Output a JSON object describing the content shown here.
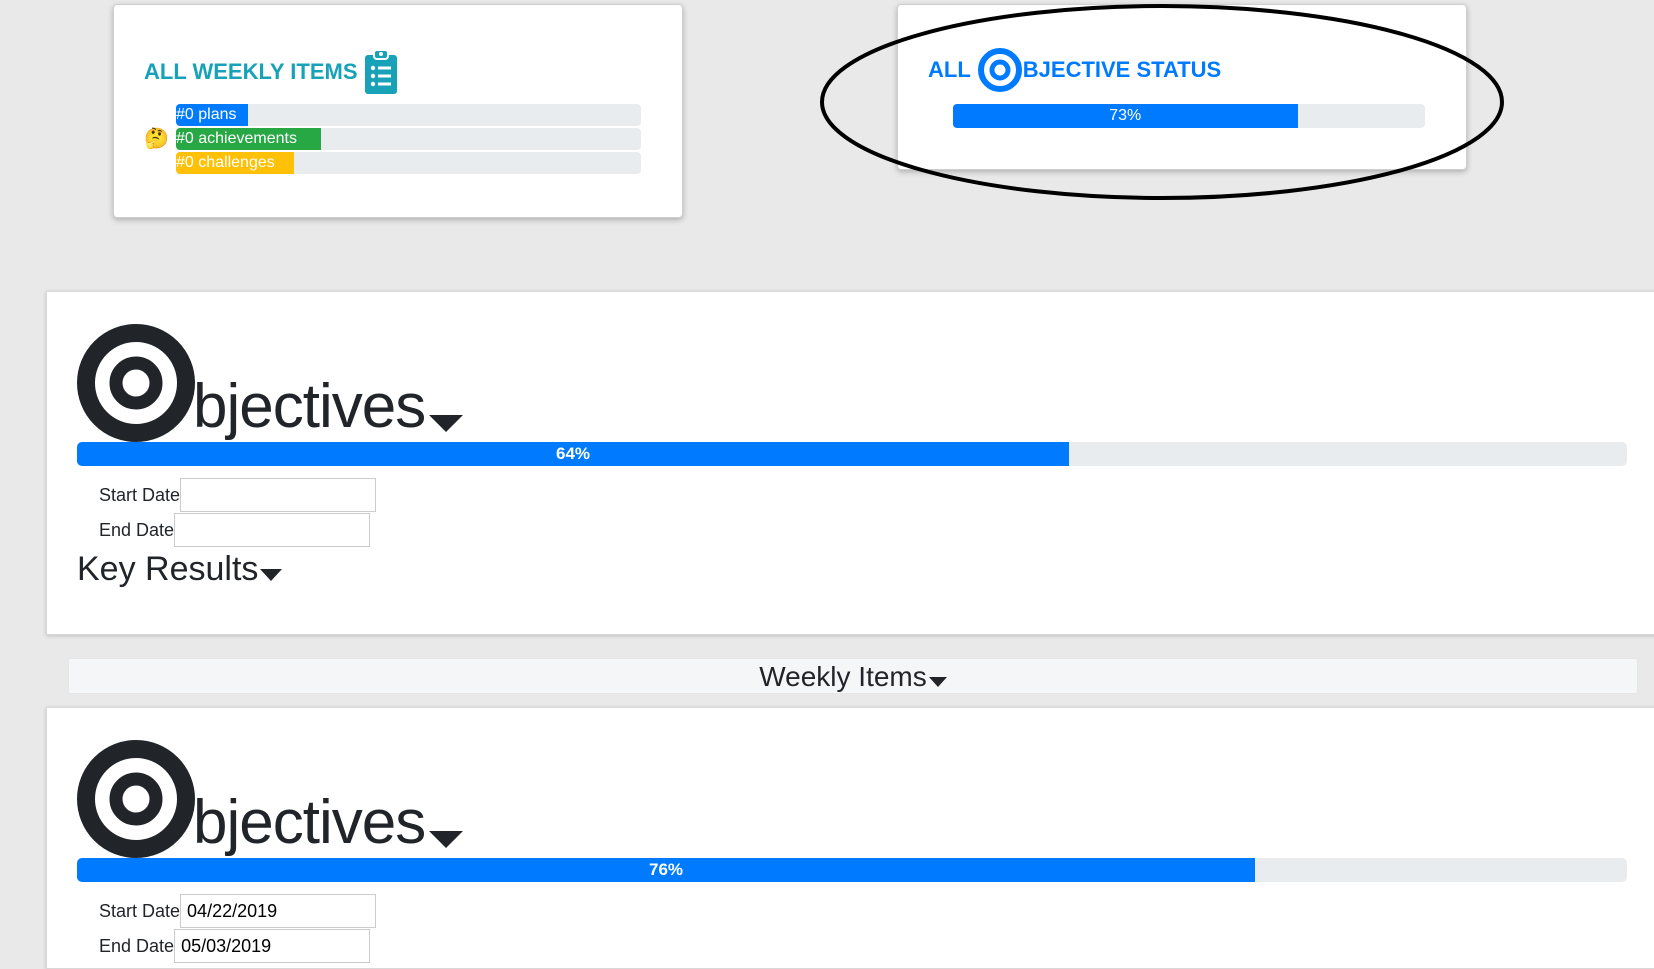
{
  "weekly_card": {
    "title": "ALL WEEKLY ITEMS",
    "icon": "clipboard-list-icon",
    "emoji": "🤔",
    "plans_label": "#0 plans",
    "achievements_label": "#0 achievements",
    "challenges_label": "#0 challenges",
    "colors": {
      "title": "#17a2b8",
      "plans": "#007bff",
      "achievements": "#28a745",
      "challenges": "#ffc107"
    }
  },
  "status_card": {
    "title_prefix": "ALL",
    "title_suffix": "BJECTIVE STATUS",
    "icon": "target-icon",
    "progress": 73,
    "progress_label": "73%",
    "color": "#007bff"
  },
  "objectives_1": {
    "heading": "bjectives",
    "icon": "target-icon",
    "progress": 64,
    "progress_label": "64%",
    "start_date_label": "Start Date",
    "start_date_value": "",
    "end_date_label": "End Date",
    "end_date_value": "",
    "key_results_label": "Key Results"
  },
  "weekly_items_bar": {
    "label": "Weekly Items"
  },
  "objectives_2": {
    "heading": "bjectives",
    "icon": "target-icon",
    "progress": 76,
    "progress_label": "76%",
    "start_date_label": "Start Date",
    "start_date_value": "04/22/2019",
    "end_date_label": "End Date",
    "end_date_value": "05/03/2019"
  }
}
